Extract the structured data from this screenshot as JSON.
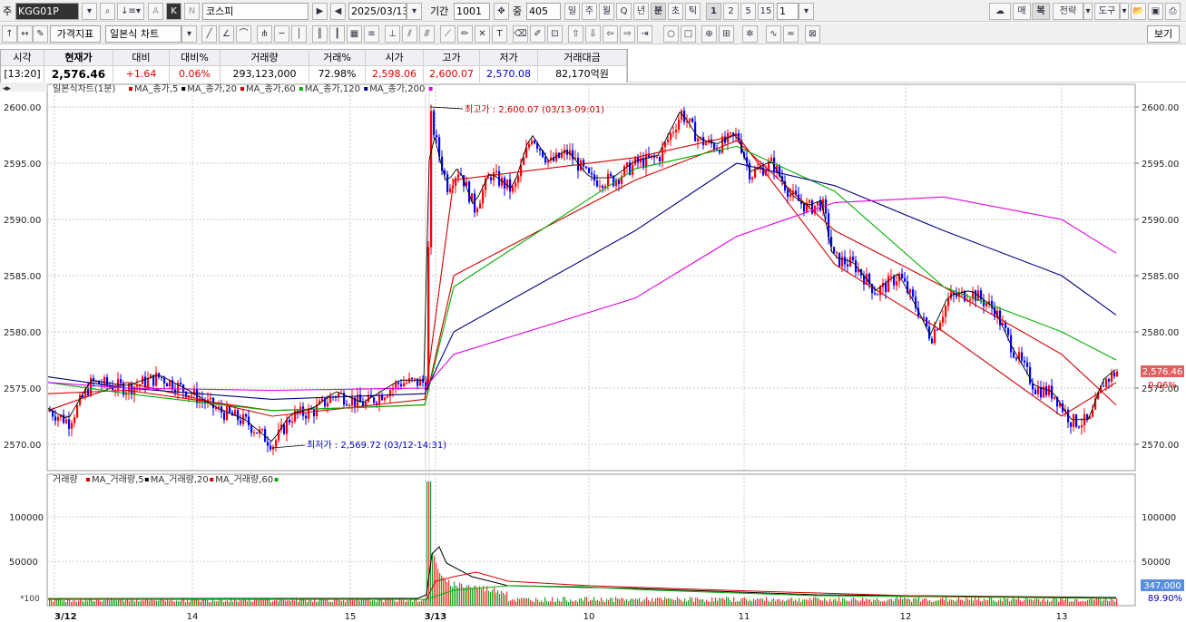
{
  "toolbar1": {
    "market_prefix": "주",
    "symbol_code": "KGG01P",
    "mode_a": "A",
    "mode_k": "K",
    "mode_n": "N",
    "stock_name": "코스피",
    "date": "2025/03/13",
    "period_label": "기간",
    "period_value": "1001",
    "count_label": "중",
    "count_value": "405",
    "timeframes": [
      "일",
      "주",
      "월",
      "Q",
      "년",
      "분",
      "초",
      "틱"
    ],
    "minutes": [
      "1",
      "2",
      "5",
      "15"
    ],
    "minute_select": "1",
    "right_buttons": [
      "매",
      "복",
      "전략",
      "도구"
    ]
  },
  "toolbar2": {
    "indicator_btn": "가격지표",
    "chart_type": "일본식 차트",
    "view_btn": "보기"
  },
  "info": {
    "headers": [
      "시각",
      "현재가",
      "대비",
      "대비%",
      "거래량",
      "거래%",
      "시가",
      "고가",
      "저가",
      "거래대금"
    ],
    "values": [
      "[13:20]",
      "2,576.46",
      "+1.64",
      "0.06%",
      "293,123,000",
      "72.98%",
      "2,598.06",
      "2,600.07",
      "2,570.08",
      "82,170억원"
    ]
  },
  "price_panel": {
    "legend_title": "일본식차트(1분)",
    "legend_items": [
      {
        "label": "MA_종가,5",
        "color": "#d00000"
      },
      {
        "label": "MA_종가,20",
        "color": "#000000"
      },
      {
        "label": "MA_종가,60",
        "color": "#d00000"
      },
      {
        "label": "MA_종가,120",
        "color": "#00b000"
      },
      {
        "label": "MA_종가,200",
        "color": "#000080"
      },
      {
        "label": "",
        "color": "#e000e0"
      }
    ],
    "y_ticks": [
      "2600.00",
      "2595.00",
      "2590.00",
      "2585.00",
      "2580.00",
      "2575.00",
      "2570.00"
    ],
    "high_annotation": "최고가 : 2,600.07 (03/13-09:01)",
    "low_annotation": "최저가 : 2,569.72 (03/12-14:31)",
    "current_price_tag": "2,576.46",
    "current_change_tag": "0.06%"
  },
  "volume_panel": {
    "legend_title": "거래량",
    "legend_items": [
      {
        "label": "MA_거래량,5",
        "color": "#d00000"
      },
      {
        "label": "MA_거래량,20",
        "color": "#000000"
      },
      {
        "label": "MA_거래량,60",
        "color": "#d00000"
      },
      {
        "label": "",
        "color": "#00b000"
      }
    ],
    "y_ticks": [
      "100000",
      "50000"
    ],
    "scale_label": "*100",
    "volume_tag": "347,000",
    "volume_pct_tag": "89.90%"
  },
  "x_axis": {
    "labels": [
      "3/12",
      "14",
      "15",
      "3/13",
      "10",
      "11",
      "12",
      "13"
    ]
  },
  "colors": {
    "up": "#ff0000",
    "down": "#0000ff",
    "ma5": "#d00000",
    "ma20": "#000000",
    "ma60": "#d00000",
    "ma120": "#00b000",
    "ma200": "#000080",
    "ma_extra": "#e000e0"
  },
  "chart_data": {
    "type": "line",
    "title": "일본식차트(1분)",
    "ylim": [
      2568,
      2602
    ],
    "x": [
      "3/12",
      "14",
      "15",
      "3/13",
      "10",
      "11",
      "12",
      "13"
    ],
    "series": [
      {
        "name": "MA_종가,5",
        "values": [
          2573.0,
          2575.5,
          2572.5,
          2574.0,
          2593.5,
          2595.5,
          2597.5,
          2586.0,
          2580.0,
          2572.5,
          2575.5
        ]
      },
      {
        "name": "MA_종가,60",
        "values": [
          2574.5,
          2574.8,
          2573.0,
          2573.5,
          2585.0,
          2593.5,
          2597.0,
          2589.0,
          2584.0,
          2578.0,
          2573.5
        ]
      },
      {
        "name": "MA_종가,120",
        "values": [
          2575.5,
          2574.5,
          2573.0,
          2573.5,
          2584.0,
          2594.5,
          2596.5,
          2592.5,
          2584.0,
          2580.0,
          2577.5
        ]
      },
      {
        "name": "MA_종가,200",
        "values": [
          2576.0,
          2575.0,
          2574.0,
          2574.5,
          2580.0,
          2589.0,
          2595.0,
          2593.0,
          2589.0,
          2585.0,
          2581.5
        ]
      },
      {
        "name": "",
        "values": [
          2575.5,
          2575.0,
          2574.8,
          2575.0,
          2578.0,
          2583.0,
          2588.5,
          2591.5,
          2592.0,
          2590.0,
          2587.0
        ]
      }
    ],
    "annotations": [
      {
        "text": "최고가 : 2,600.07 (03/13-09:01)",
        "y": 2600.07
      },
      {
        "text": "최저가 : 2,569.72 (03/12-14:31)",
        "y": 2569.72
      }
    ],
    "current": {
      "price": 2576.46,
      "change_pct": "0.06%"
    }
  }
}
